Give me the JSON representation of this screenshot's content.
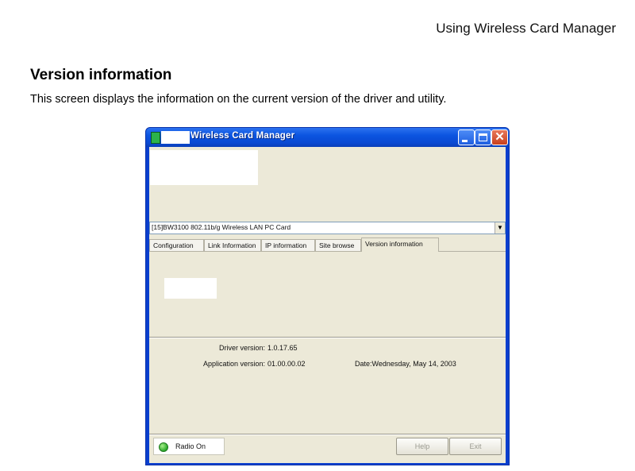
{
  "page": {
    "header": "Using Wireless Card Manager",
    "heading": "Version information",
    "description": "This screen displays the information on the current version of the driver and utility."
  },
  "window": {
    "title": "Wireless Card Manager",
    "title_bar_color": "#0a49d2",
    "card_select": {
      "value": "[15]BW3100 802.11b/g Wireless LAN PC Card"
    },
    "tabs": [
      {
        "label": "Configuration",
        "selected": false
      },
      {
        "label": "Link Information",
        "selected": false
      },
      {
        "label": "IP information",
        "selected": false
      },
      {
        "label": "Site browse",
        "selected": false
      },
      {
        "label": "Version information",
        "selected": true
      }
    ],
    "version_info": {
      "driver_label": "Driver version:",
      "driver_value": "1.0.17.65",
      "app_label": "Application version:",
      "app_value": "01.00.00.02",
      "date_text": "Date:Wednesday, May 14, 2003"
    },
    "status": {
      "text": "Radio On",
      "led_color": "#2ba82a"
    },
    "buttons": {
      "help": "Help",
      "exit": "Exit"
    }
  }
}
